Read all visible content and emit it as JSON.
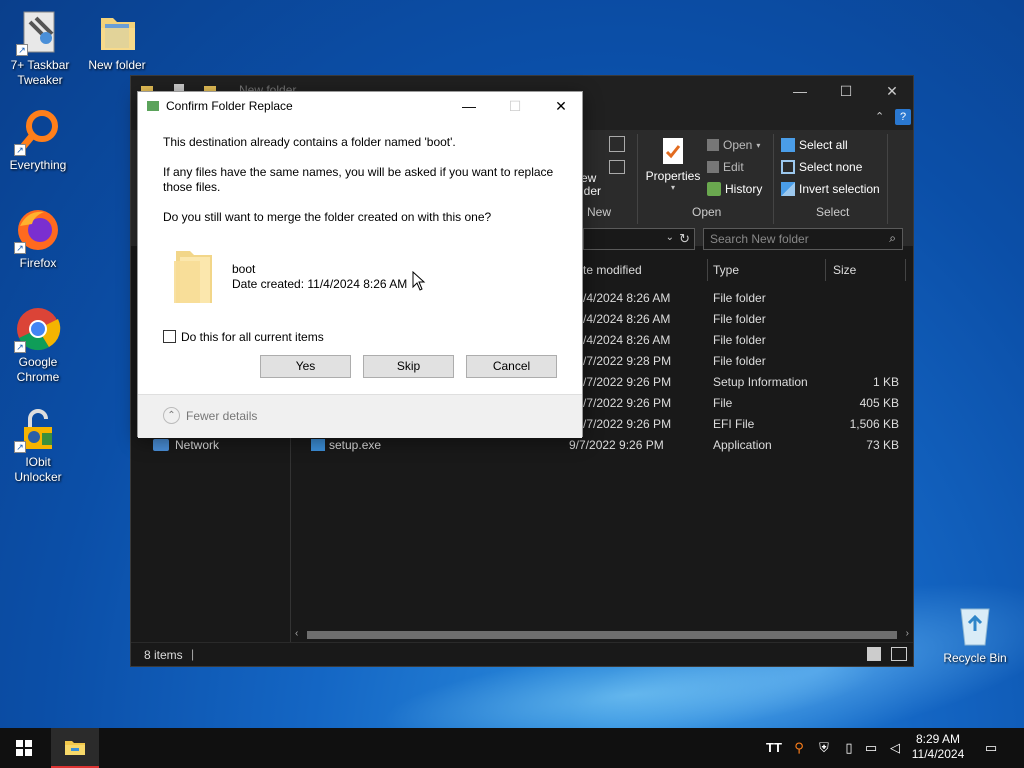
{
  "desktop": {
    "icons": [
      {
        "label": "7+ Taskbar Tweaker"
      },
      {
        "label": "New folder"
      },
      {
        "label": "Everything"
      },
      {
        "label": "Firefox"
      },
      {
        "label": "Google Chrome"
      },
      {
        "label": "IObit Unlocker"
      },
      {
        "label": "Recycle Bin"
      }
    ]
  },
  "explorer": {
    "title": "New folder",
    "ribbon": {
      "new_group": {
        "label": "New",
        "new_folder_fragment": "ew\nlder"
      },
      "open_group": {
        "label": "Open",
        "properties": "Properties",
        "open": "Open",
        "edit": "Edit",
        "history": "History"
      },
      "select_group": {
        "label": "Select",
        "select_all": "Select all",
        "select_none": "Select none",
        "invert_selection": "Invert selection"
      }
    },
    "search_placeholder": "Search New folder",
    "columns": {
      "date": "te modified",
      "type": "Type",
      "size": "Size"
    },
    "nav": {
      "network": "Network"
    },
    "rows": [
      {
        "name": "",
        "date": "/4/2024 8:26 AM",
        "type": "File folder",
        "size": ""
      },
      {
        "name": "",
        "date": "/4/2024 8:26 AM",
        "type": "File folder",
        "size": ""
      },
      {
        "name": "",
        "date": "/4/2024 8:26 AM",
        "type": "File folder",
        "size": ""
      },
      {
        "name": "",
        "date": "/7/2022 9:28 PM",
        "type": "File folder",
        "size": ""
      },
      {
        "name": "",
        "date": "/7/2022 9:26 PM",
        "type": "Setup Information",
        "size": "1 KB"
      },
      {
        "name": "",
        "date": "/7/2022 9:26 PM",
        "type": "File",
        "size": "405 KB"
      },
      {
        "name": "",
        "date": "/7/2022 9:26 PM",
        "type": "EFI File",
        "size": "1,506 KB"
      },
      {
        "name": "setup.exe",
        "date": "9/7/2022 9:26 PM",
        "type": "Application",
        "size": "73 KB"
      }
    ],
    "status": {
      "items": "8 items"
    }
  },
  "dialog": {
    "title": "Confirm Folder Replace",
    "line1": "This destination already contains a folder named 'boot'.",
    "line2a": "If any files have the same names, you will be asked if you want to replace",
    "line2b": "those files.",
    "line3": "Do you still want to merge the folder created on  with this one?",
    "folder_name": "boot",
    "date_created": "Date created: 11/4/2024 8:26 AM",
    "checkbox_label": "Do this for all current items",
    "yes": "Yes",
    "skip": "Skip",
    "cancel": "Cancel",
    "fewer_details": "Fewer details"
  },
  "taskbar": {
    "time": "8:29 AM",
    "date": "11/4/2024"
  }
}
